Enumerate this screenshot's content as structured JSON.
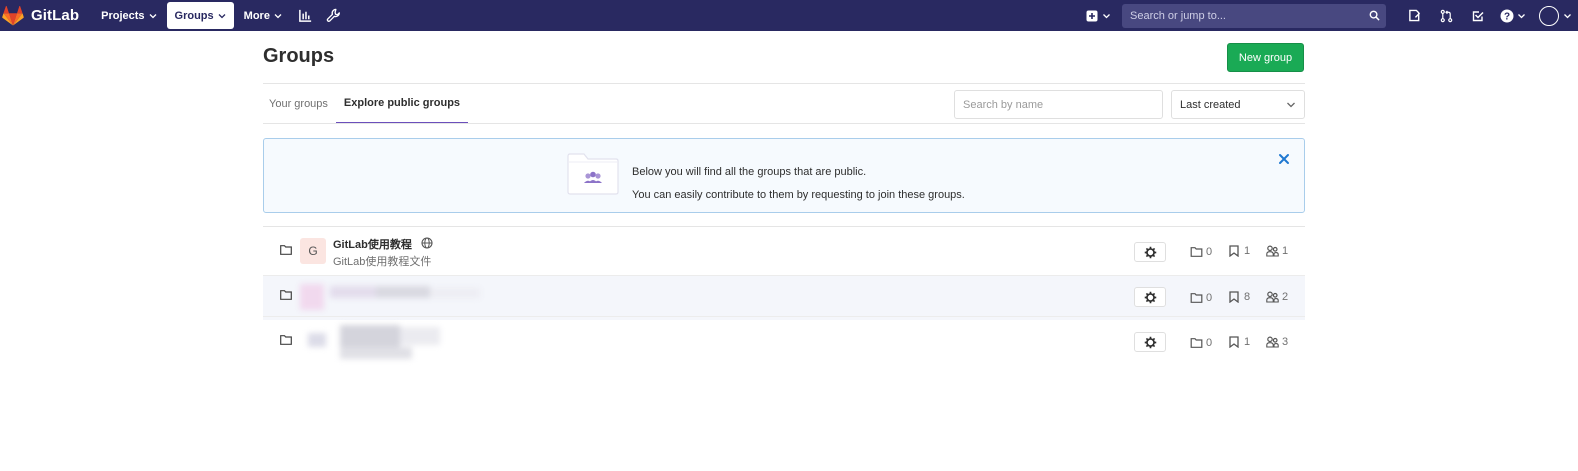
{
  "navbar": {
    "brand": "GitLab",
    "items": [
      {
        "label": "Projects",
        "active": false
      },
      {
        "label": "Groups",
        "active": true
      },
      {
        "label": "More",
        "active": false
      }
    ],
    "icons": [
      "activity-chart-icon",
      "wrench-icon"
    ],
    "search_placeholder": "Search or jump to...",
    "right_icons": [
      "plus-square-icon",
      "search-icon",
      "issues-icon",
      "merge-request-icon",
      "todo-check-icon",
      "help-icon",
      "user-avatar-icon"
    ],
    "color": "#292961"
  },
  "page": {
    "title": "Groups",
    "new_group_label": "New group",
    "tabs": [
      {
        "label": "Your groups",
        "active": false
      },
      {
        "label": "Explore public groups",
        "active": true
      }
    ],
    "filter_placeholder": "Search by name",
    "sort_selected": "Last created"
  },
  "notice": {
    "line1": "Below you will find all the groups that are public.",
    "line2": "You can easily contribute to them by requesting to join these groups."
  },
  "groups": [
    {
      "avatar_letter": "G",
      "name": "GitLab使用教程",
      "description": "GitLab使用教程文件",
      "visibility_icon": "globe-icon",
      "subgroups": "0",
      "projects": "1",
      "members": "1"
    },
    {
      "avatar_letter": "",
      "name": "",
      "description": "",
      "redacted": true,
      "subgroups": "0",
      "projects": "8",
      "members": "2"
    },
    {
      "avatar_letter": "",
      "name": "",
      "description": "",
      "redacted": true,
      "subgroups": "0",
      "projects": "1",
      "members": "3"
    }
  ],
  "colors": {
    "accent_green": "#1aaa55",
    "tab_underline": "#6b4fbb",
    "notice_border": "#a9cdeb",
    "close_blue": "#1f78d1"
  }
}
